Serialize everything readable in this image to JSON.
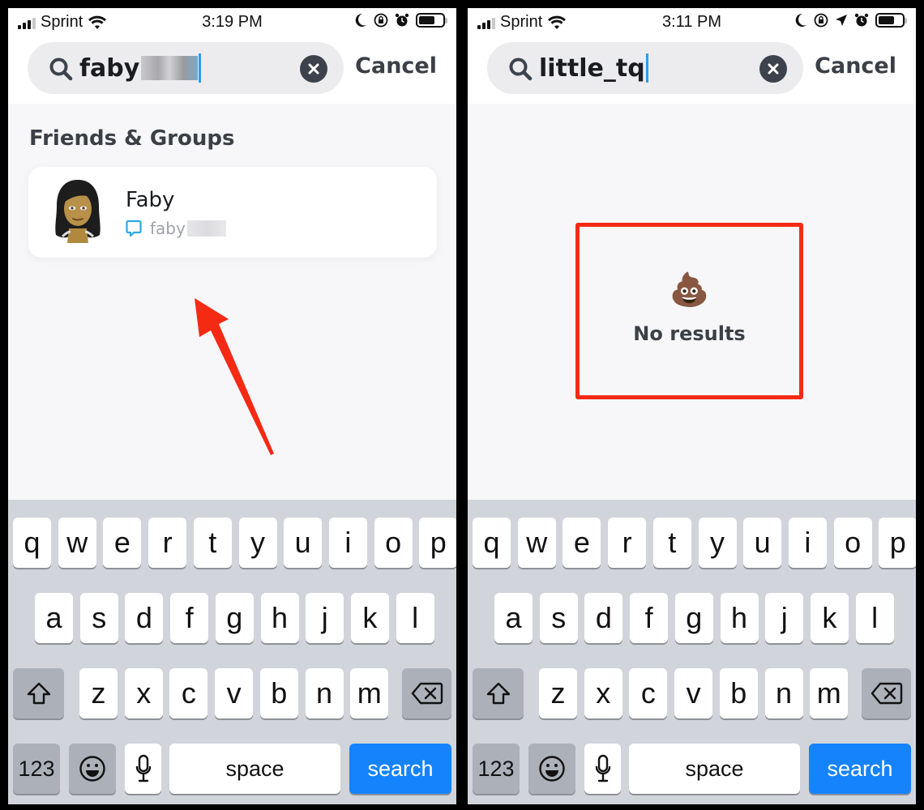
{
  "phones": {
    "left": {
      "status_bar": {
        "carrier": "Sprint",
        "time": "3:19 PM",
        "icons": [
          "signal-icon",
          "wifi-icon",
          "moon-icon",
          "rotation-lock-icon",
          "alarm-icon",
          "battery-icon"
        ]
      },
      "search": {
        "query_visible": "faby",
        "query_redacted": true,
        "clear_icon": "clear-icon",
        "cancel_label": "Cancel"
      },
      "section_title": "Friends & Groups",
      "results": [
        {
          "name": "Faby",
          "username_visible": "faby",
          "username_redacted": true,
          "avatar": "bitmoji-avatar",
          "icon": "chat-icon"
        }
      ],
      "annotation": {
        "type": "arrow",
        "color": "#f52a14",
        "points_to": "friend result"
      }
    },
    "right": {
      "status_bar": {
        "carrier": "Sprint",
        "time": "3:11 PM",
        "icons": [
          "signal-icon",
          "wifi-icon",
          "moon-icon",
          "rotation-lock-icon",
          "location-icon",
          "alarm-icon",
          "battery-icon"
        ]
      },
      "search": {
        "query": "little_tq",
        "clear_icon": "clear-icon",
        "cancel_label": "Cancel"
      },
      "empty_state": {
        "emoji": "💩",
        "text": "No results"
      },
      "annotation": {
        "type": "highlight-box",
        "color": "#f52a14"
      }
    }
  },
  "keyboard": {
    "row1": [
      "q",
      "w",
      "e",
      "r",
      "t",
      "y",
      "u",
      "i",
      "o",
      "p"
    ],
    "row2": [
      "a",
      "s",
      "d",
      "f",
      "g",
      "h",
      "j",
      "k",
      "l"
    ],
    "row3": [
      "z",
      "x",
      "c",
      "v",
      "b",
      "n",
      "m"
    ],
    "numbers_label": "123",
    "space_label": "space",
    "action_label": "search",
    "shift_icon": "shift-icon",
    "backspace_icon": "backspace-icon",
    "emoji_icon": "emoji-icon",
    "mic_icon": "microphone-icon"
  },
  "colors": {
    "accent_blue": "#1583fb",
    "annotation_red": "#f52a14",
    "caret_blue": "#2c9cf0",
    "chat_icon_blue": "#2aa9e0"
  }
}
